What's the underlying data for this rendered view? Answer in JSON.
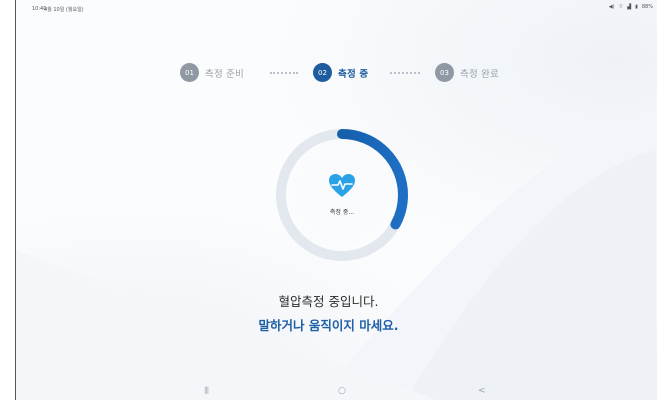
{
  "status_bar": {
    "time": "10:40",
    "date": "4월 10일 (월요일)",
    "battery": "88%"
  },
  "steps": [
    {
      "num": "01",
      "label": "측정 준비",
      "state": "inactive"
    },
    {
      "num": "02",
      "label": "측정 중",
      "state": "active"
    },
    {
      "num": "03",
      "label": "측정 완료",
      "state": "inactive"
    }
  ],
  "progress": {
    "label": "측정 중...",
    "fraction": 0.33
  },
  "messages": {
    "primary": "혈압측정 중입니다.",
    "secondary": "말하거나 움직이지 마세요."
  },
  "nav": {
    "recent": "|||",
    "home": "○",
    "back": "<"
  },
  "colors": {
    "active": "#1f5c9e",
    "inactive_step": "#8f98a3",
    "ring_track": "#e3e8ee",
    "heart": "#2aa3e6"
  }
}
